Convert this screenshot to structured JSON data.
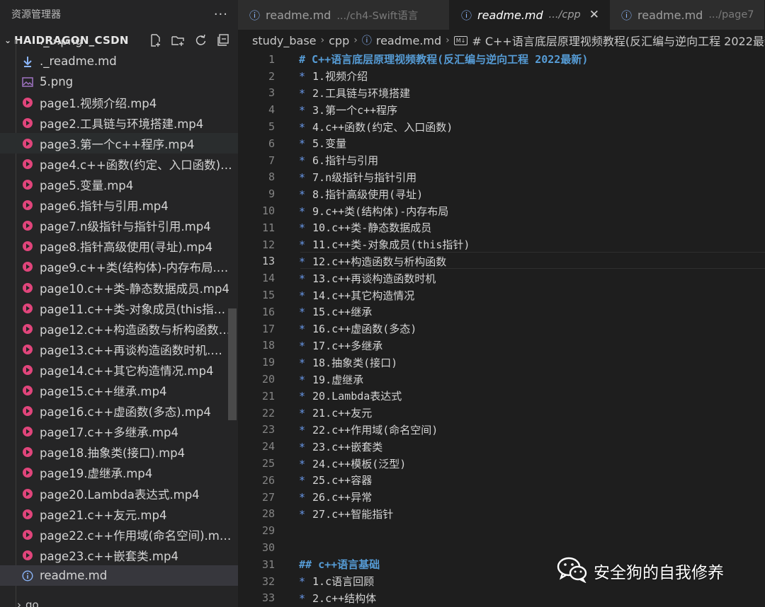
{
  "sidebar": {
    "title": "资源管理器",
    "more": "···",
    "project": "HAIDRAGON_CSDN",
    "partial_item": "._5.png",
    "files": [
      {
        "name": "._readme.md",
        "type": "download"
      },
      {
        "name": "5.png",
        "type": "image"
      },
      {
        "name": "page1.视频介绍.mp4",
        "type": "video"
      },
      {
        "name": "page2.工具链与环境搭建.mp4",
        "type": "video"
      },
      {
        "name": "page3.第一个c++程序.mp4",
        "type": "video"
      },
      {
        "name": "page4.c++函数(约定、入口函数)....",
        "type": "video"
      },
      {
        "name": "page5.变量.mp4",
        "type": "video"
      },
      {
        "name": "page6.指针与引用.mp4",
        "type": "video"
      },
      {
        "name": "page7.n级指针与指针引用.mp4",
        "type": "video"
      },
      {
        "name": "page8.指针高级使用(寻址).mp4",
        "type": "video"
      },
      {
        "name": "page9.c++类(结构体)-内存布局.m...",
        "type": "video"
      },
      {
        "name": "page10.c++类-静态数据成员.mp4",
        "type": "video"
      },
      {
        "name": "page11.c++类-对象成员(this指针)....",
        "type": "video"
      },
      {
        "name": "page12.c++构造函数与析构函数....",
        "type": "video"
      },
      {
        "name": "page13.c++再谈构造函数时机.mp4",
        "type": "video"
      },
      {
        "name": "page14.c++其它构造情况.mp4",
        "type": "video"
      },
      {
        "name": "page15.c++继承.mp4",
        "type": "video"
      },
      {
        "name": "page16.c++虚函数(多态).mp4",
        "type": "video"
      },
      {
        "name": "page17.c++多继承.mp4",
        "type": "video"
      },
      {
        "name": "page18.抽象类(接口).mp4",
        "type": "video"
      },
      {
        "name": "page19.虚继承.mp4",
        "type": "video"
      },
      {
        "name": "page20.Lambda表达式.mp4",
        "type": "video"
      },
      {
        "name": "page21.c++友元.mp4",
        "type": "video"
      },
      {
        "name": "page22.c++作用域(命名空间).mp4",
        "type": "video"
      },
      {
        "name": "page23.c++嵌套类.mp4",
        "type": "video"
      },
      {
        "name": "readme.md",
        "type": "info"
      }
    ],
    "hover_index": 4,
    "selected_index": 25,
    "next_folder": "go"
  },
  "tabs": [
    {
      "name": "readme.md",
      "path": ".../ch4-Swift语言",
      "active": false
    },
    {
      "name": "readme.md",
      "path": ".../cpp",
      "active": true,
      "close": "✕"
    },
    {
      "name": "readme.md",
      "path": ".../page7",
      "active": false
    }
  ],
  "breadcrumb": [
    "study_base",
    "cpp",
    "readme.md",
    "# C++语言底层原理视频教程(反汇编与逆向工程 2022最新)"
  ],
  "editor": {
    "current_line": 13,
    "lines": [
      {
        "n": "1",
        "kind": "heading",
        "text": "# C++语言底层原理视频教程(反汇编与逆向工程 2022最新)"
      },
      {
        "n": "2",
        "kind": "bullet",
        "text": "1.视频介绍"
      },
      {
        "n": "3",
        "kind": "bullet",
        "text": "2.工具链与环境搭建"
      },
      {
        "n": "4",
        "kind": "bullet",
        "text": "3.第一个c++程序"
      },
      {
        "n": "5",
        "kind": "bullet",
        "text": "4.c++函数(约定、入口函数)"
      },
      {
        "n": "6",
        "kind": "bullet",
        "text": "5.变量"
      },
      {
        "n": "7",
        "kind": "bullet",
        "text": "6.指针与引用"
      },
      {
        "n": "8",
        "kind": "bullet",
        "text": "7.n级指针与指针引用"
      },
      {
        "n": "9",
        "kind": "bullet",
        "text": "8.指针高级使用(寻址)"
      },
      {
        "n": "10",
        "kind": "bullet",
        "text": "9.c++类(结构体)-内存布局"
      },
      {
        "n": "11",
        "kind": "bullet",
        "text": "10.c++类-静态数据成员"
      },
      {
        "n": "12",
        "kind": "bullet",
        "text": "11.c++类-对象成员(this指针)"
      },
      {
        "n": "13",
        "kind": "bullet",
        "text": "12.c++构造函数与析构函数"
      },
      {
        "n": "14",
        "kind": "bullet",
        "text": "13.c++再谈构造函数时机"
      },
      {
        "n": "15",
        "kind": "bullet",
        "text": "14.c++其它构造情况"
      },
      {
        "n": "16",
        "kind": "bullet",
        "text": "15.c++继承"
      },
      {
        "n": "17",
        "kind": "bullet",
        "text": "16.c++虚函数(多态)"
      },
      {
        "n": "18",
        "kind": "bullet",
        "text": "17.c++多继承"
      },
      {
        "n": "19",
        "kind": "bullet",
        "text": "18.抽象类(接口)"
      },
      {
        "n": "20",
        "kind": "bullet",
        "text": "19.虚继承"
      },
      {
        "n": "21",
        "kind": "bullet",
        "text": "20.Lambda表达式"
      },
      {
        "n": "22",
        "kind": "bullet",
        "text": "21.c++友元"
      },
      {
        "n": "23",
        "kind": "bullet",
        "text": "22.c++作用域(命名空间)"
      },
      {
        "n": "24",
        "kind": "bullet",
        "text": "23.c++嵌套类"
      },
      {
        "n": "25",
        "kind": "bullet",
        "text": "24.c++模板(泛型)"
      },
      {
        "n": "26",
        "kind": "bullet",
        "text": "25.c++容器"
      },
      {
        "n": "27",
        "kind": "bullet",
        "text": "26.c++异常"
      },
      {
        "n": "28",
        "kind": "bullet",
        "text": "27.c++智能指针"
      },
      {
        "n": "29",
        "kind": "empty",
        "text": ""
      },
      {
        "n": "30",
        "kind": "empty",
        "text": ""
      },
      {
        "n": "31",
        "kind": "heading",
        "text": "## c++语言基础"
      },
      {
        "n": "32",
        "kind": "bullet",
        "text": "1.c语言回顾"
      },
      {
        "n": "33",
        "kind": "bullet",
        "text": "2.c++结构体"
      }
    ]
  },
  "watermark": {
    "text": "安全狗的自我修养",
    "icon": "wechat-icon"
  },
  "colors": {
    "editor_bg": "#1e1e1e",
    "sidebar_bg": "#252526",
    "heading": "#569cd6",
    "bullet": "#6796e6",
    "video_icon": "#e0457b",
    "info_icon": "#8ab4f8"
  }
}
